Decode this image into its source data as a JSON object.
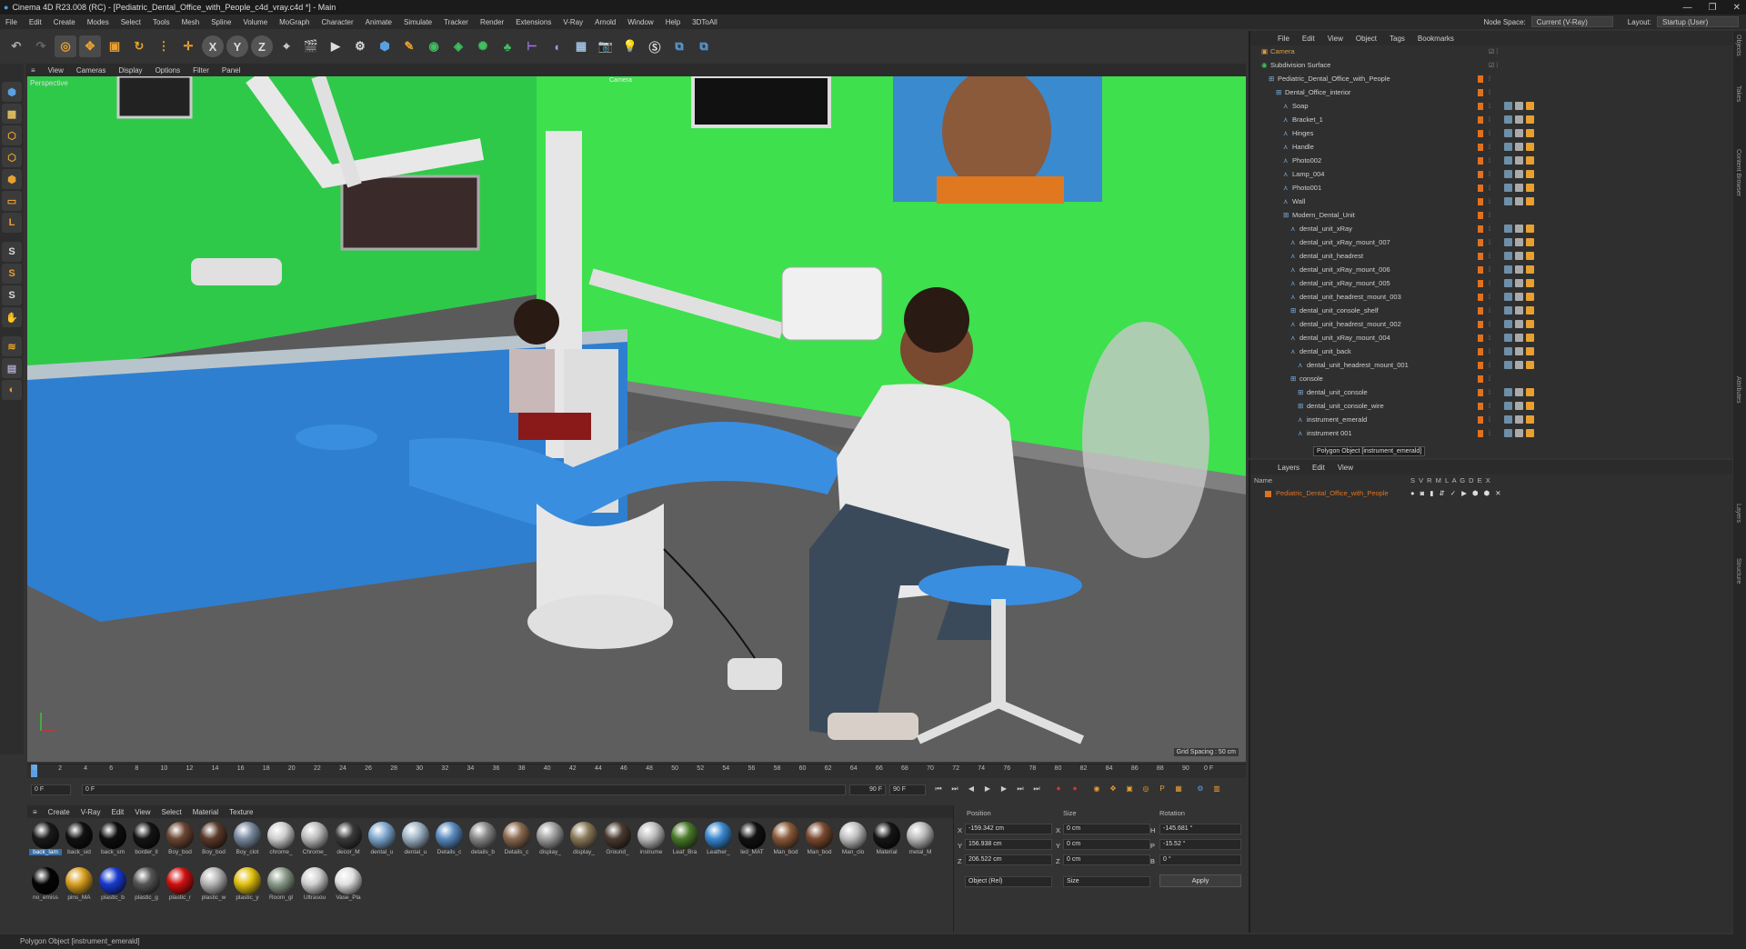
{
  "window": {
    "title": "Cinema 4D R23.008 (RC) - [Pediatric_Dental_Office_with_People_c4d_vray.c4d *] - Main"
  },
  "menu": [
    "File",
    "Edit",
    "Create",
    "Modes",
    "Select",
    "Tools",
    "Mesh",
    "Spline",
    "Volume",
    "MoGraph",
    "Character",
    "Animate",
    "Simulate",
    "Tracker",
    "Render",
    "Extensions",
    "V-Ray",
    "Arnold",
    "Window",
    "Help",
    "3DToAll"
  ],
  "header": {
    "node_space_label": "Node Space:",
    "node_space_value": "Current (V-Ray)",
    "layout_label": "Layout:",
    "layout_value": "Startup (User)"
  },
  "viewport": {
    "menu": [
      "View",
      "Cameras",
      "Display",
      "Options",
      "Filter",
      "Panel"
    ],
    "label": "Perspective",
    "camera_label": "Camera",
    "grid_spacing": "Grid Spacing : 50 cm"
  },
  "timeline": {
    "ticks": [
      "0",
      "2",
      "4",
      "6",
      "8",
      "10",
      "12",
      "14",
      "16",
      "18",
      "20",
      "22",
      "24",
      "26",
      "28",
      "30",
      "32",
      "34",
      "36",
      "38",
      "40",
      "42",
      "44",
      "46",
      "48",
      "50",
      "52",
      "54",
      "56",
      "58",
      "60",
      "62",
      "64",
      "66",
      "68",
      "70",
      "72",
      "74",
      "76",
      "78",
      "80",
      "82",
      "84",
      "86",
      "88",
      "90"
    ],
    "end_label": "0 F",
    "start_field": "0 F",
    "current_field": "0 F",
    "end_field": "90 F",
    "end_field2": "90 F"
  },
  "materials": {
    "menu": [
      "Create",
      "V-Ray",
      "Edit",
      "View",
      "Select",
      "Material",
      "Texture"
    ],
    "row1": [
      {
        "name": "back_lam",
        "color": "#1a1a1a"
      },
      {
        "name": "back_sid",
        "color": "#111"
      },
      {
        "name": "back_sm",
        "color": "#0e0e0e"
      },
      {
        "name": "border_ll",
        "color": "#141414"
      },
      {
        "name": "Boy_bod",
        "color": "#6b4632"
      },
      {
        "name": "Boy_bod",
        "color": "#5a3a2a"
      },
      {
        "name": "Boy_clot",
        "color": "#7a8aa0"
      },
      {
        "name": "chrome_",
        "color": "#cfcfcf"
      },
      {
        "name": "Chrome_",
        "color": "#bdbdbd"
      },
      {
        "name": "decor_M",
        "color": "#3a3a3a"
      },
      {
        "name": "dental_u",
        "color": "#7fa8d0"
      },
      {
        "name": "dental_u",
        "color": "#9fb5c8"
      },
      {
        "name": "Details_c",
        "color": "#5a8ac0"
      },
      {
        "name": "details_b",
        "color": "#888"
      },
      {
        "name": "Details_c",
        "color": "#8a6a50"
      },
      {
        "name": "display_",
        "color": "#a0a0a0"
      },
      {
        "name": "display_",
        "color": "#8a7a5a"
      },
      {
        "name": "Ground_",
        "color": "#4a3a30"
      },
      {
        "name": "instrume",
        "color": "#bdbdbd"
      },
      {
        "name": "Leaf_Bra",
        "color": "#4a7a2a"
      },
      {
        "name": "Leather_",
        "color": "#3a88d0"
      },
      {
        "name": "led_MAT",
        "color": "#111"
      },
      {
        "name": "Man_bod",
        "color": "#8a5a3a"
      },
      {
        "name": "Man_bod",
        "color": "#7a4a30"
      },
      {
        "name": "Man_clo",
        "color": "#c0c0c0"
      },
      {
        "name": "Material",
        "color": "#151515"
      },
      {
        "name": "metal_M",
        "color": "#bbb"
      }
    ],
    "row2": [
      {
        "name": "no_emiss",
        "color": "#050505"
      },
      {
        "name": "pins_MA",
        "color": "#d8a020"
      },
      {
        "name": "plastic_b",
        "color": "#1a3ad0"
      },
      {
        "name": "plastic_g",
        "color": "#555"
      },
      {
        "name": "plastic_r",
        "color": "#d01010"
      },
      {
        "name": "plastic_w",
        "color": "#b5b5b5"
      },
      {
        "name": "plastic_y",
        "color": "#e0c010"
      },
      {
        "name": "Room_gl",
        "color": "#8a9a8a"
      },
      {
        "name": "Ultrasou",
        "color": "#d0d0d0"
      },
      {
        "name": "Vase_Pla",
        "color": "#e0e0e0"
      }
    ]
  },
  "coords": {
    "headers": [
      "Position",
      "Size",
      "Rotation"
    ],
    "rows": [
      {
        "axis": "X",
        "pos": "-159.342 cm",
        "saxis": "X",
        "size": "0 cm",
        "raxis": "H",
        "rot": "-145.681 °"
      },
      {
        "axis": "Y",
        "pos": "156.938 cm",
        "saxis": "Y",
        "size": "0 cm",
        "raxis": "P",
        "rot": "-15.52 °"
      },
      {
        "axis": "Z",
        "pos": "206.522 cm",
        "saxis": "Z",
        "size": "0 cm",
        "raxis": "B",
        "rot": "0 °"
      }
    ],
    "mode": "Object (Rel)",
    "size_mode": "Size",
    "apply": "Apply"
  },
  "object_manager": {
    "menu": [
      "File",
      "Edit",
      "View",
      "Object",
      "Tags",
      "Bookmarks"
    ],
    "items": [
      {
        "name": "Camera",
        "depth": 0,
        "color": "#e0a040"
      },
      {
        "name": "Subdivision Surface",
        "depth": 0,
        "color": "#cfcfcf"
      },
      {
        "name": "Pediatric_Dental_Office_with_People",
        "depth": 1,
        "color": "#cfcfcf"
      },
      {
        "name": "Dental_Office_interior",
        "depth": 2,
        "color": "#cfcfcf"
      },
      {
        "name": "Soap",
        "depth": 3,
        "color": "#cfcfcf"
      },
      {
        "name": "Bracket_1",
        "depth": 3,
        "color": "#cfcfcf"
      },
      {
        "name": "Hinges",
        "depth": 3,
        "color": "#cfcfcf"
      },
      {
        "name": "Handle",
        "depth": 3,
        "color": "#cfcfcf"
      },
      {
        "name": "Photo002",
        "depth": 3,
        "color": "#cfcfcf"
      },
      {
        "name": "Lamp_004",
        "depth": 3,
        "color": "#cfcfcf"
      },
      {
        "name": "Photo001",
        "depth": 3,
        "color": "#cfcfcf"
      },
      {
        "name": "Wall",
        "depth": 3,
        "color": "#cfcfcf"
      },
      {
        "name": "Modern_Dental_Unit",
        "depth": 3,
        "color": "#cfcfcf"
      },
      {
        "name": "dental_unit_xRay",
        "depth": 4,
        "color": "#cfcfcf"
      },
      {
        "name": "dental_unit_xRay_mount_007",
        "depth": 4,
        "color": "#cfcfcf"
      },
      {
        "name": "dental_unit_headrest",
        "depth": 4,
        "color": "#cfcfcf"
      },
      {
        "name": "dental_unit_xRay_mount_006",
        "depth": 4,
        "color": "#cfcfcf"
      },
      {
        "name": "dental_unit_xRay_mount_005",
        "depth": 4,
        "color": "#cfcfcf"
      },
      {
        "name": "dental_unit_headrest_mount_003",
        "depth": 4,
        "color": "#cfcfcf"
      },
      {
        "name": "dental_unit_console_shelf",
        "depth": 4,
        "color": "#cfcfcf"
      },
      {
        "name": "dental_unit_headrest_mount_002",
        "depth": 4,
        "color": "#cfcfcf"
      },
      {
        "name": "dental_unit_xRay_mount_004",
        "depth": 4,
        "color": "#cfcfcf"
      },
      {
        "name": "dental_unit_back",
        "depth": 4,
        "color": "#cfcfcf"
      },
      {
        "name": "dental_unit_headrest_mount_001",
        "depth": 5,
        "color": "#cfcfcf"
      },
      {
        "name": "console",
        "depth": 4,
        "color": "#cfcfcf"
      },
      {
        "name": "dental_unit_console",
        "depth": 5,
        "color": "#cfcfcf"
      },
      {
        "name": "dental_unit_console_wire",
        "depth": 5,
        "color": "#cfcfcf"
      },
      {
        "name": "instrument_emerald",
        "depth": 5,
        "color": "#cfcfcf"
      },
      {
        "name": "instrument 001",
        "depth": 5,
        "color": "#cfcfcf"
      }
    ],
    "tooltip": "Polygon Object [instrument_emerald]"
  },
  "layers": {
    "menu": [
      "Layers",
      "Edit",
      "View"
    ],
    "name_header": "Name",
    "flags": "S V R M L A G D E X",
    "layer": "Pediatric_Dental_Office_with_People"
  },
  "right_tabs": [
    "Objects",
    "Takes",
    "Content Browser",
    "Attributes",
    "Layers",
    "Structure"
  ],
  "status": "Polygon Object [instrument_emerald]"
}
